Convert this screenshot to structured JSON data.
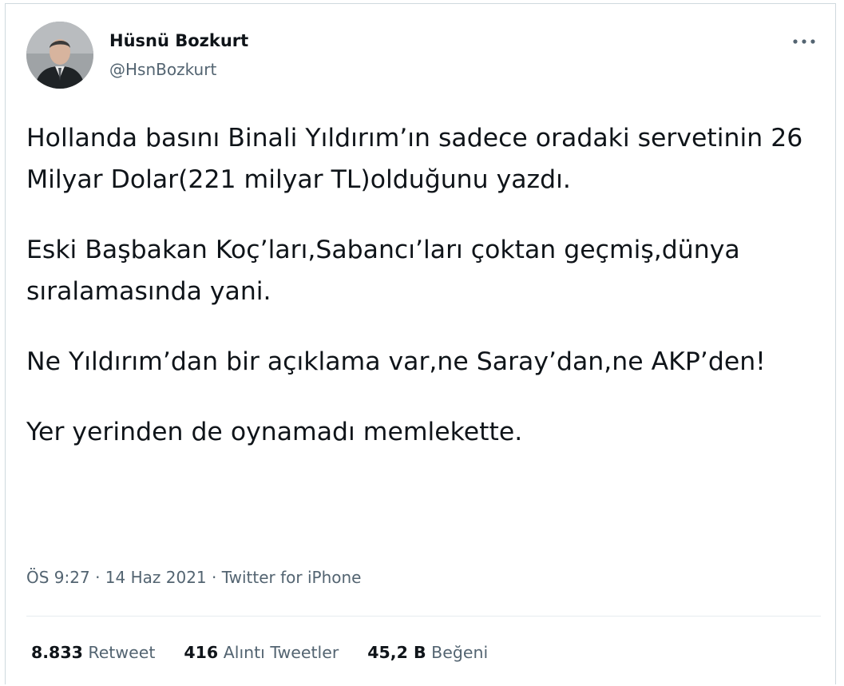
{
  "author": {
    "name": "Hüsnü Bozkurt",
    "handle": "@HsnBozkurt",
    "avatar_icon": "profile-photo"
  },
  "more_icon": "more-horizontal-icon",
  "tweet": {
    "paragraphs": [
      "Hollanda basını Binali Yıldırım’ın sadece oradaki servetinin 26 Milyar Dolar(221 milyar TL)olduğunu yazdı.",
      "Eski Başbakan Koç’ları,Sabancı’ları çoktan geçmiş,dünya sıralamasında yani.",
      "Ne Yıldırım’dan bir açıklama var,ne Saray’dan,ne AKP’den!",
      "Yer yerinden de oynamadı memlekette."
    ],
    "time": "ÖS 9:27",
    "separator": " · ",
    "date": "14 Haz 2021",
    "source": "Twitter for iPhone"
  },
  "stats": {
    "retweets_count": "8.833",
    "retweets_label": "Retweet",
    "quotes_count": "416",
    "quotes_label": "Alıntı Tweetler",
    "likes_count": "45,2 B",
    "likes_label": "Beğeni"
  },
  "colors": {
    "text": "#0f1419",
    "secondary": "#536471",
    "border": "#cfd9de"
  }
}
